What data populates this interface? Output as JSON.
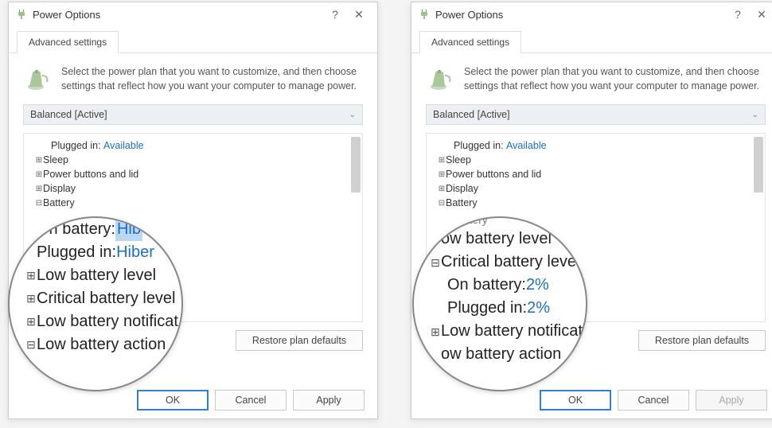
{
  "window": {
    "title": "Power Options",
    "tab": "Advanced settings",
    "description": "Select the power plan that you want to customize, and then choose settings that reflect how you want your computer to manage power.",
    "plan": "Balanced [Active]",
    "restore": "Restore plan defaults",
    "ok": "OK",
    "cancel": "Cancel",
    "apply": "Apply"
  },
  "treeA": {
    "plugged": {
      "label": "Plugged in:",
      "value": "Available"
    },
    "items": [
      "Sleep",
      "Power buttons and lid",
      "Display",
      "Battery"
    ]
  },
  "treeB": {
    "plugged": {
      "label": "Plugged in:",
      "value": "Available"
    },
    "items": [
      "Sleep",
      "Power buttons and lid",
      "Display",
      "Battery"
    ]
  },
  "magA": {
    "row0": {
      "label": "On battery: ",
      "value": "Hib"
    },
    "row1": {
      "label": "Plugged in: ",
      "value": "Hiber"
    },
    "rows": [
      "Low battery level",
      "Critical battery level",
      "Low battery notificat",
      "Low battery action"
    ]
  },
  "magB": {
    "top": "ow battery level",
    "group": "Critical battery level",
    "row0": {
      "label": "On battery: ",
      "value": "2%"
    },
    "row1": {
      "label": "Plugged in: ",
      "value": "2%"
    },
    "rows": [
      "Low battery notificat",
      "ow battery action"
    ],
    "topcut": [
      "Ba",
      "battery"
    ]
  }
}
